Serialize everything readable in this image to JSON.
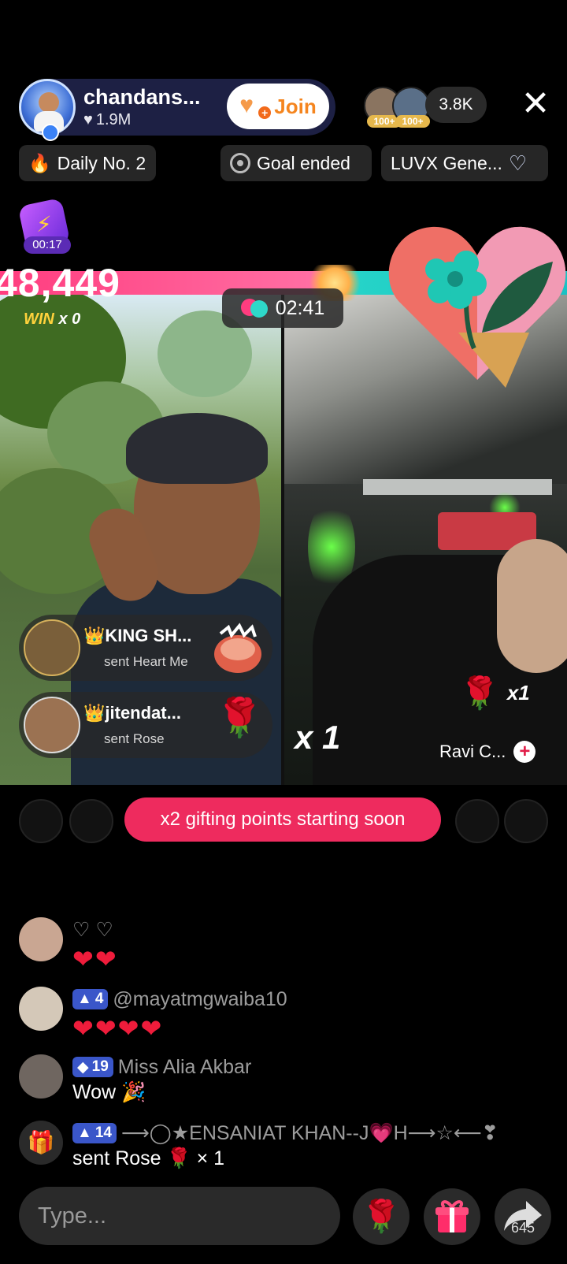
{
  "host": {
    "name": "chandans...",
    "likes": "1.9M",
    "join_label": "Join"
  },
  "viewers": {
    "badge_1": "100+",
    "badge_2": "100+",
    "count": "3.8K"
  },
  "chips": {
    "daily": "Daily No. 2",
    "goal": "Goal ended",
    "gen": "LUVX Gene..."
  },
  "timer": {
    "time": "00:17"
  },
  "battle": {
    "score": "48,449",
    "win_label": "WIN",
    "win_count": "x 0",
    "time": "02:41",
    "left_share": 0.59
  },
  "gift_notifications": [
    {
      "name": "👑KING SH...",
      "sent": "sent Heart Me"
    },
    {
      "name": "👑jitendat...",
      "sent": "sent Rose"
    }
  ],
  "multiplier_left": "x 1",
  "gift_right": {
    "count": "x1"
  },
  "opponent": {
    "name": "Ravi C..."
  },
  "banner": {
    "text": "x2 gifting points starting soon"
  },
  "chat": [
    {
      "name": "♡  ♡",
      "level": "",
      "message": "❤❤"
    },
    {
      "name": "@mayatmgwaiba10",
      "level": "4",
      "message": "❤❤❤❤"
    },
    {
      "name": "Miss Alia Akbar",
      "level": "19",
      "message": "Wow 🎉"
    },
    {
      "name": "⟶◯★ENSANIAT KHAN--J💗H⟶☆⟵❣",
      "level": "14",
      "message": "sent Rose 🌹 × 1"
    }
  ],
  "input": {
    "placeholder": "Type..."
  },
  "share": {
    "count": "645"
  },
  "colors": {
    "accent_pink": "#ee2b5e",
    "battle_left": "#ff3d7f",
    "battle_right": "#27d5c8",
    "join_orange": "#f5851f"
  }
}
